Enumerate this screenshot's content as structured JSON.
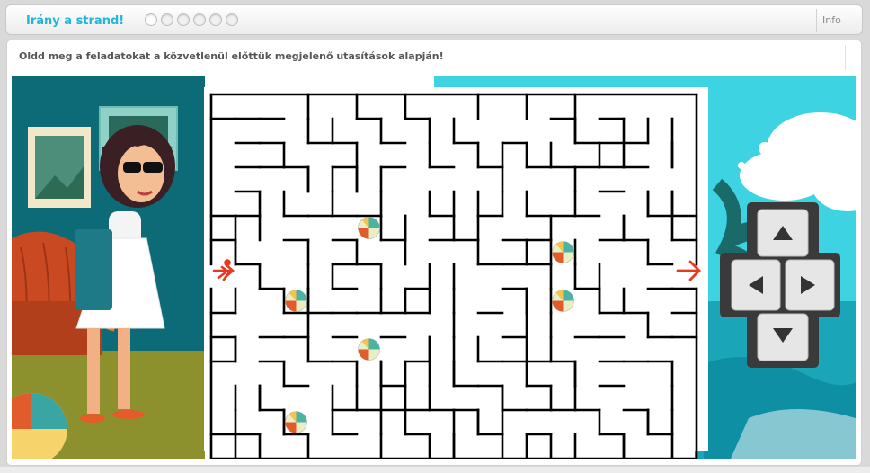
{
  "header": {
    "title": "Irány a strand!",
    "progress": {
      "total": 6,
      "current": 1
    },
    "info_label": "Info"
  },
  "instruction": "Oldd meg a feladatokat a közvetlenül előttük megjelenő utasítások alapján!",
  "maze": {
    "entry_icon": "runner-arrow-icon",
    "exit_icon": "arrow-right-icon",
    "ball_count": 7
  },
  "controls": {
    "up": "arrow-up-icon",
    "left": "arrow-left-icon",
    "right": "arrow-right-icon",
    "down": "arrow-down-icon"
  },
  "colors": {
    "accent": "#26b5d6",
    "arrow": "#e8381f",
    "wall_teal": "#0c6b77",
    "sky": "#3ed3e2"
  }
}
